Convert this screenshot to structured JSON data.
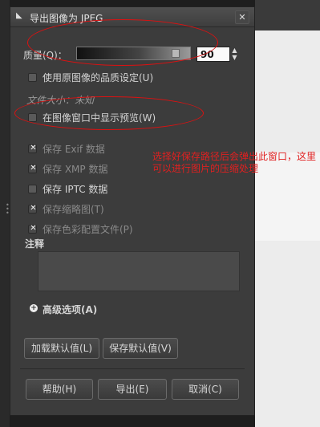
{
  "window": {
    "title": "导出图像为 JPEG",
    "close": "✕"
  },
  "quality": {
    "label": "质量(Q)：",
    "value": "90",
    "level": 0.9
  },
  "use_original_quality": {
    "label": "使用原图像的品质设定(U)",
    "checked": false
  },
  "file_size": "文件大小：未知",
  "show_preview": {
    "label": "在图像窗口中显示预览(W)",
    "checked": false
  },
  "options": [
    {
      "label": "保存  Exif 数据",
      "checked": true,
      "dim": true
    },
    {
      "label": "保存  XMP 数据",
      "checked": true,
      "dim": true
    },
    {
      "label": "保存  IPTC 数据",
      "checked": false,
      "dim": false
    },
    {
      "label": "保存缩略图(T)",
      "checked": true,
      "dim": true
    },
    {
      "label": "保存色彩配置文件(P)",
      "checked": true,
      "dim": true
    }
  ],
  "notes": {
    "label": "注释",
    "value": ""
  },
  "advanced": {
    "label": "高级选项(A)"
  },
  "buttons": {
    "load_defaults": "加载默认值(L)",
    "save_defaults": "保存默认值(V)",
    "help": "帮助(H)",
    "export": "导出(E)",
    "cancel": "取消(C)"
  },
  "annotation": "选择好保存路径后会弹出此窗口，这里可以进行图片的压缩处理",
  "colors": {
    "dialog_bg": "#3c3c3c",
    "annotation_red": "#e02020"
  }
}
